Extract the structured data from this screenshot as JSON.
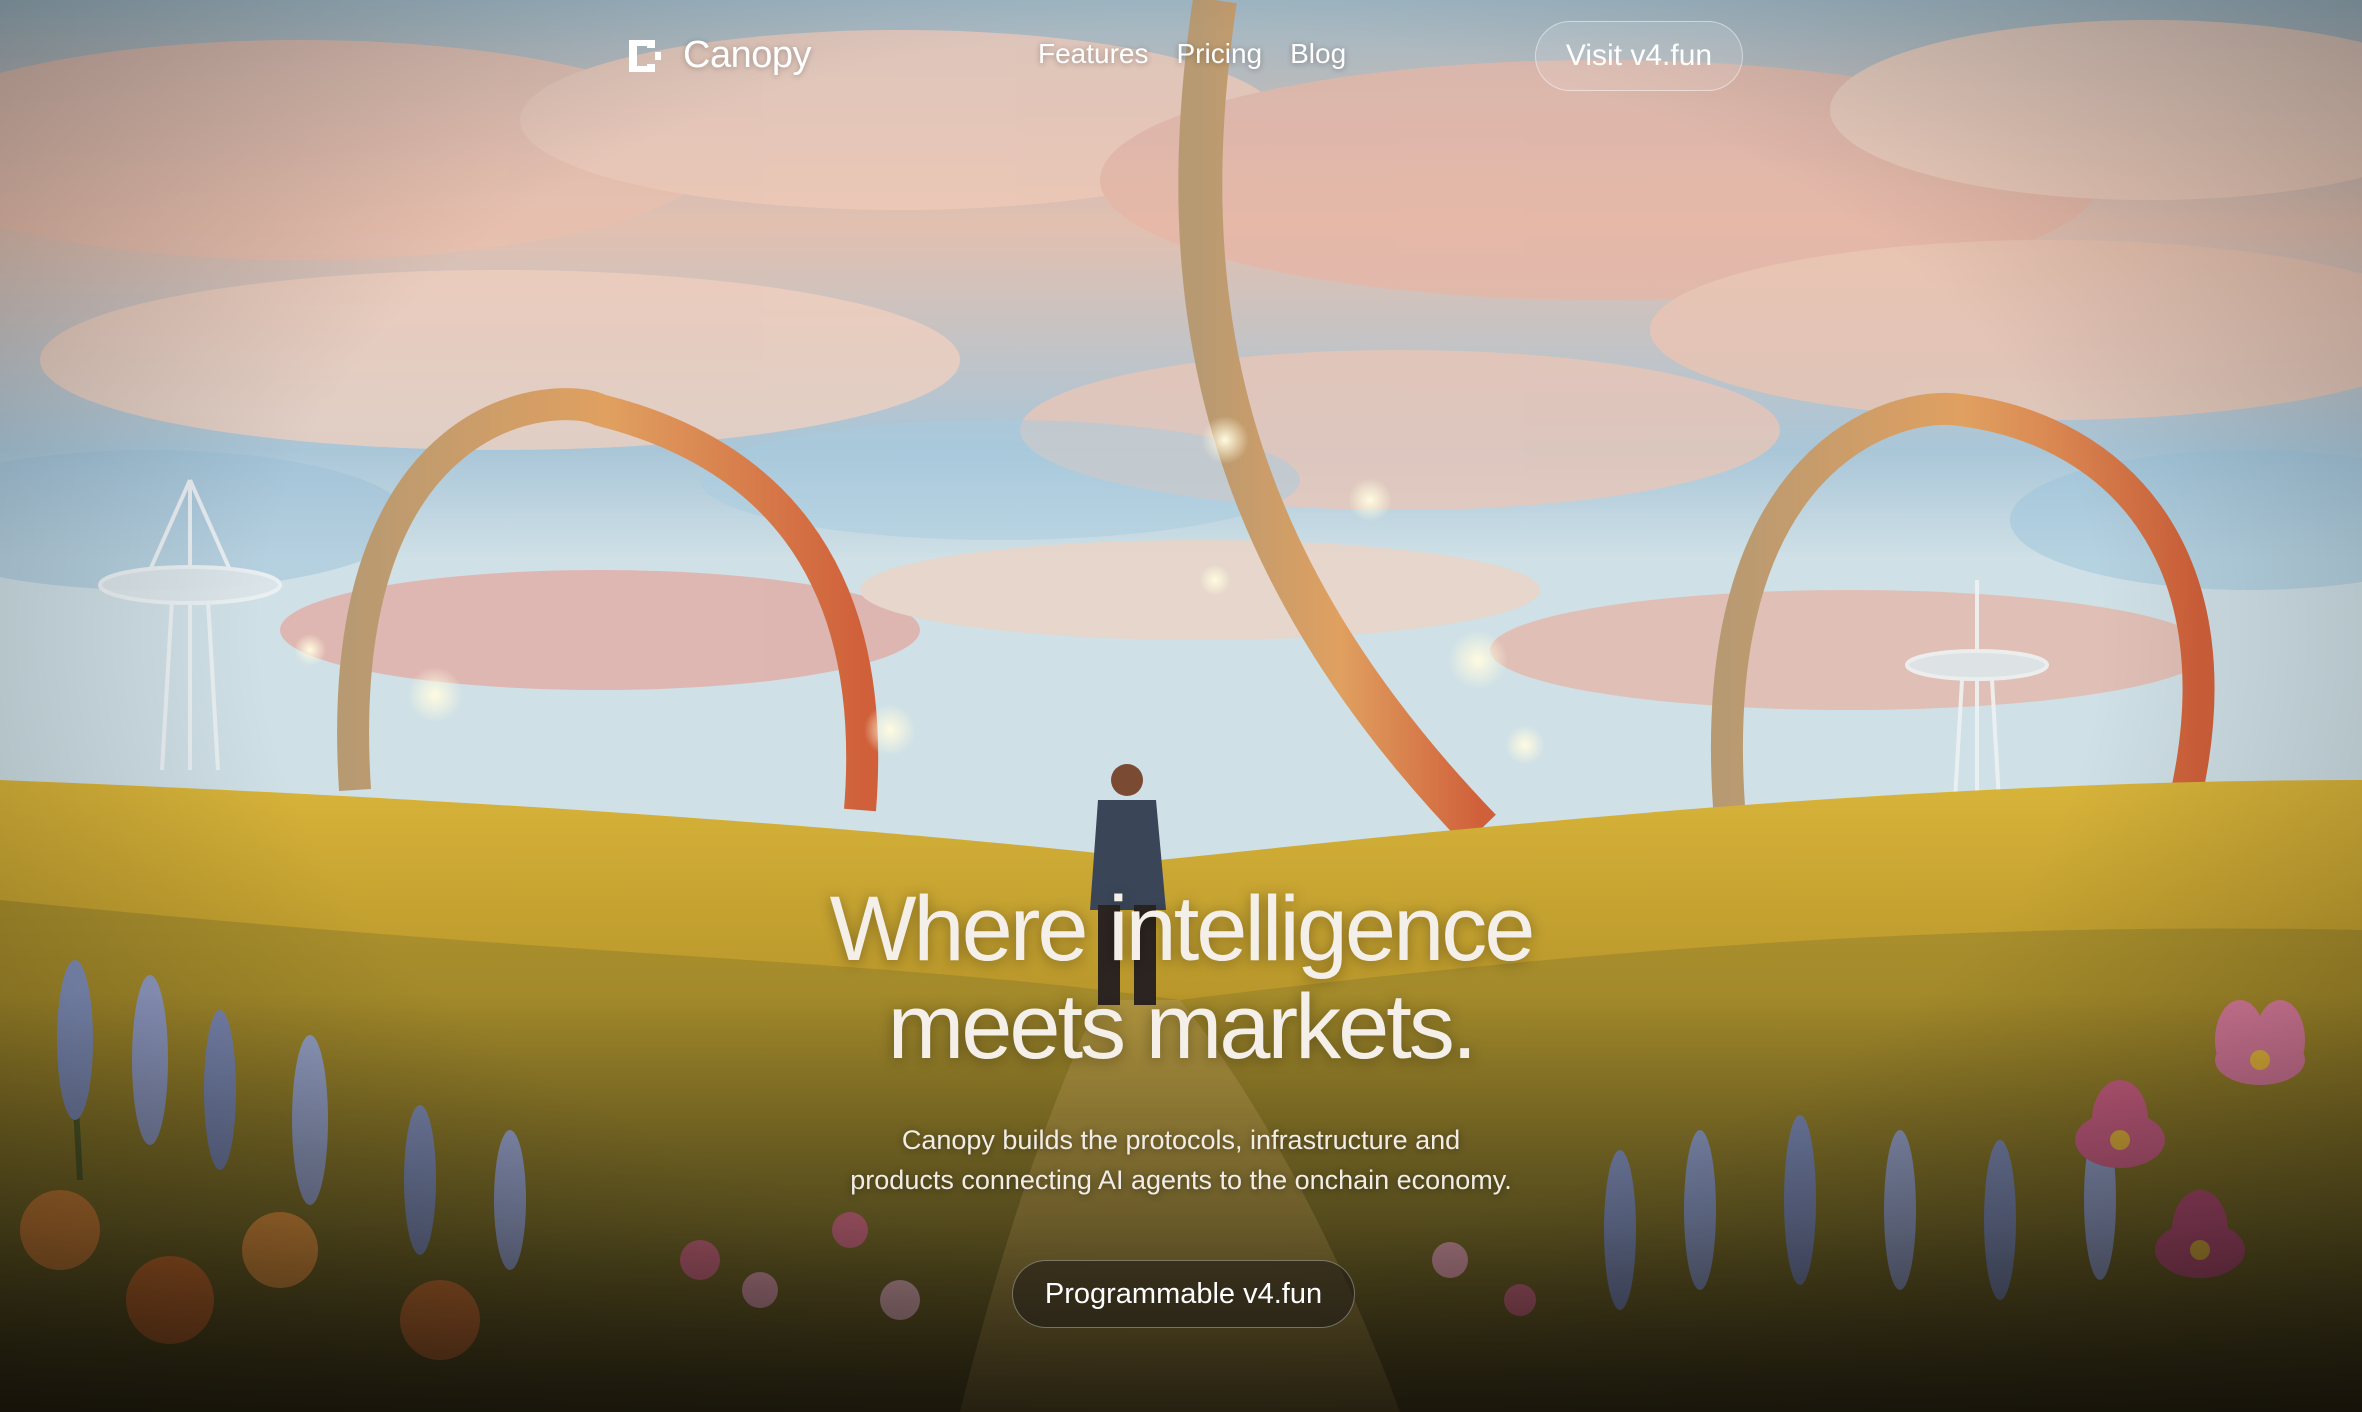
{
  "brand": {
    "name": "Canopy",
    "logo_icon": "canopy-bracket-icon"
  },
  "nav": {
    "links": [
      {
        "label": "Features"
      },
      {
        "label": "Pricing"
      },
      {
        "label": "Blog"
      }
    ],
    "cta_label": "Visit v4.fun"
  },
  "hero": {
    "title_line1": "Where intelligence",
    "title_line2": "meets markets.",
    "subtitle_line1": "Canopy builds the protocols, infrastructure and",
    "subtitle_line2": "products connecting AI agents to the onchain economy.",
    "cta_label": "Programmable v4.fun"
  },
  "colors": {
    "text": "#ffffff",
    "sky_blue": "#8fb6cf",
    "cloud_pink": "#e8b8a6",
    "meadow": "#c9a32c",
    "arch": "#d98a4a"
  }
}
